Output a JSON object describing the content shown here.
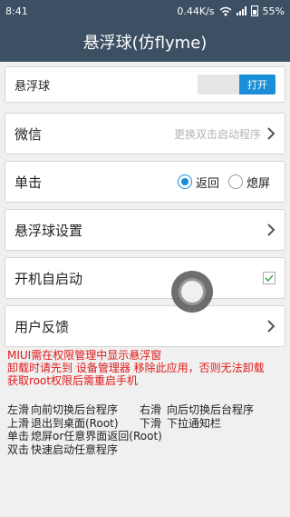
{
  "status_bar": {
    "time": "8:41",
    "network_speed": "0.44K/s",
    "battery": "55%"
  },
  "app": {
    "title": "悬浮球(仿flyme)"
  },
  "settings": {
    "float_ball": {
      "label": "悬浮球",
      "toggle_label": "打开",
      "enabled": true
    },
    "wechat": {
      "label": "微信",
      "hint": "更换双击启动程序"
    },
    "single_tap": {
      "label": "单击",
      "options": [
        "返回",
        "熄屏"
      ],
      "selected": "返回"
    },
    "ball_settings": {
      "label": "悬浮球设置"
    },
    "autostart": {
      "label": "开机自启动",
      "checked": true
    },
    "feedback": {
      "label": "用户反馈"
    }
  },
  "notes": {
    "line1": "MIUI需在权限管理中显示悬浮窗",
    "line2": "卸载时请先到 设备管理器 移除此应用，否则无法卸载",
    "line3": "获取root权限后需重启手机"
  },
  "gestures": [
    {
      "key1": "左滑",
      "val1": "向前切换后台程序",
      "key2": "右滑",
      "val2": "向后切换后台程序"
    },
    {
      "key1": "上滑",
      "val1": "退出到桌面(Root)",
      "key2": "下滑",
      "val2": "下拉通知栏"
    },
    {
      "key1": "单击",
      "val1": "熄屏or任意界面返回(Root)",
      "key2": "",
      "val2": ""
    },
    {
      "key1": "双击",
      "val1": "快速启动任意程序",
      "key2": "",
      "val2": ""
    }
  ],
  "colors": {
    "bar": "#3d4f62",
    "accent": "#1a8fd8",
    "warning_text": "#e01919"
  }
}
